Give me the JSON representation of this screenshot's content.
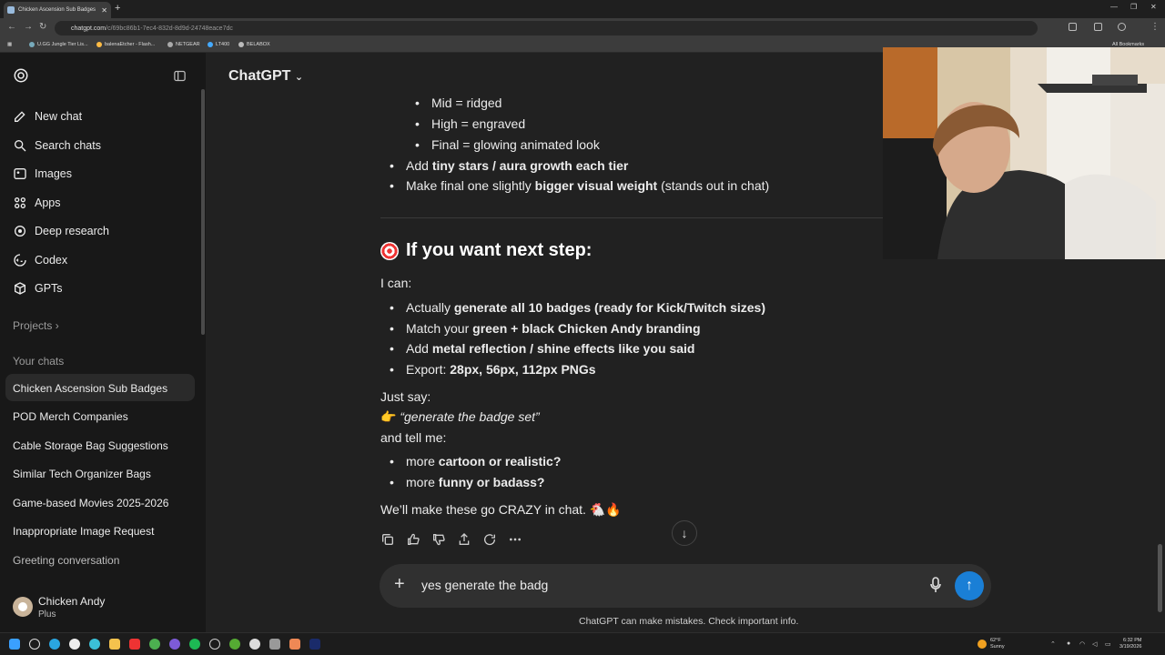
{
  "browser": {
    "tab_title": "Chicken Ascension Sub Badges",
    "new_tab": "+",
    "url_host": "chatgpt.com",
    "url_path": "/c/69bc86b1-7ec4-832d-8d9d-24748eace7dc",
    "bookmarks": [
      "U.GG Jungle Tier Lis...",
      "balenaEtcher - Flash...",
      "NETGEAR",
      "LT400",
      "BELABOX"
    ],
    "all_bookmarks": "All Bookmarks"
  },
  "sidebar": {
    "nav": [
      {
        "label": "New chat",
        "icon": "pencil-icon"
      },
      {
        "label": "Search chats",
        "icon": "search-icon"
      },
      {
        "label": "Images",
        "icon": "image-icon"
      },
      {
        "label": "Apps",
        "icon": "apps-icon"
      },
      {
        "label": "Deep research",
        "icon": "telescope-icon"
      },
      {
        "label": "Codex",
        "icon": "codex-icon"
      },
      {
        "label": "GPTs",
        "icon": "cube-icon"
      }
    ],
    "projects_label": "Projects",
    "your_chats_label": "Your chats",
    "chats": [
      "Chicken Ascension Sub Badges",
      "POD Merch Companies",
      "Cable Storage Bag Suggestions",
      "Similar Tech Organizer Bags",
      "Game-based Movies 2025-2026",
      "Inappropriate Image Request",
      "Greeting conversation"
    ],
    "user_name": "Chicken Andy",
    "user_plan": "Plus"
  },
  "main": {
    "model_title": "ChatGPT",
    "sub_bullets": [
      "Mid = ridged",
      "High = engraved",
      "Final = glowing animated look"
    ],
    "bullet_tiny_stars_pre": "Add ",
    "bullet_tiny_stars_bold": "tiny stars / aura growth each tier",
    "bullet_final_pre": "Make final one slightly ",
    "bullet_final_bold": "bigger visual weight",
    "bullet_final_post": " (stands out in chat)",
    "heading": "If you want next step:",
    "i_can": "I can:",
    "can_list": [
      {
        "pre": "Actually ",
        "bold": "generate all 10 badges (ready for Kick/Twitch sizes)"
      },
      {
        "pre": "Match your ",
        "bold": "green + black Chicken Andy branding"
      },
      {
        "pre": "Add ",
        "bold": "metal reflection / shine effects like you said"
      },
      {
        "pre": "Export: ",
        "bold": "28px, 56px, 112px PNGs"
      }
    ],
    "just_say": "Just say:",
    "quote": "“generate the badge set”",
    "and_tell": "and tell me:",
    "tell_list": [
      {
        "pre": "more ",
        "bold": "cartoon or realistic?"
      },
      {
        "pre": "more ",
        "bold": "funny or badass?"
      }
    ],
    "closing": "We’ll make these go CRAZY in chat. 🐔🔥",
    "composer_text": "yes generate the badg",
    "disclaimer": "ChatGPT can make mistakes. Check important info."
  },
  "taskbar": {
    "weather_temp": "62°F",
    "weather_desc": "Sunny",
    "time": "6:32 PM",
    "date": "3/19/2026"
  }
}
